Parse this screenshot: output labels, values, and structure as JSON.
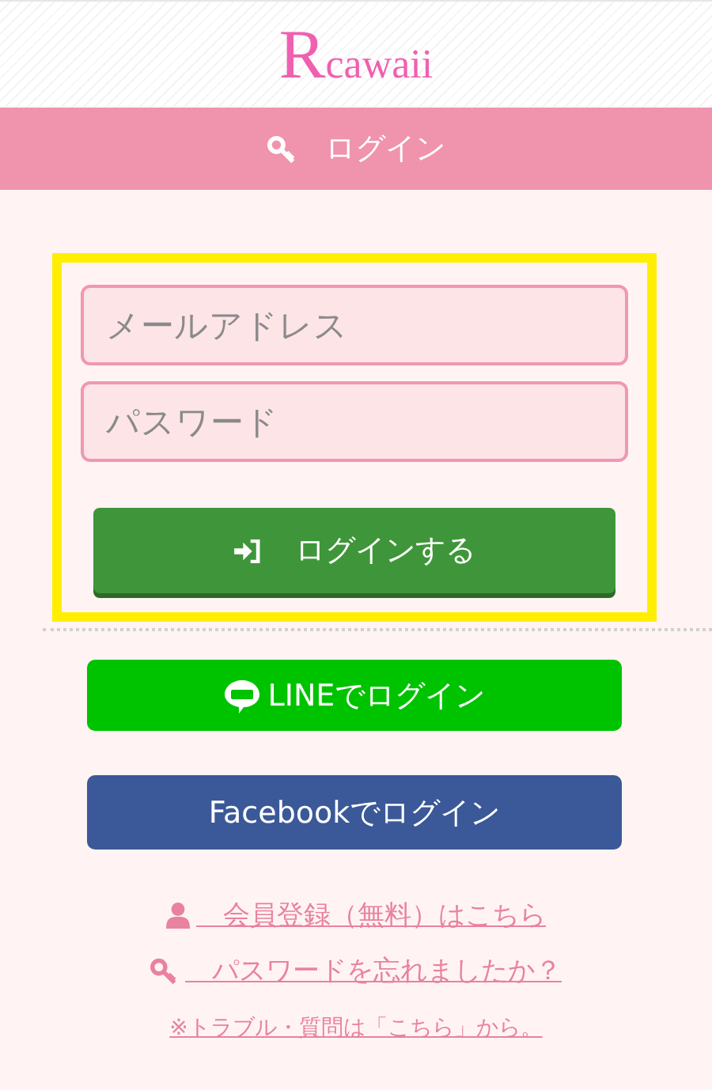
{
  "logo": "Rcawaii",
  "title_bar": {
    "label": "ログイン"
  },
  "form": {
    "highlighted": true,
    "fields": [
      {
        "placeholder": "メールアドレス"
      },
      {
        "placeholder": "パスワード"
      }
    ],
    "submit": "ログインする"
  },
  "social_buttons": [
    {
      "kind": "line",
      "label": "LINEでログイン"
    },
    {
      "kind": "facebook",
      "label": "Facebookでログイン"
    }
  ],
  "links": [
    {
      "kind": "person",
      "label": "　会員登録（無料）はこちら"
    },
    {
      "kind": "key",
      "label": "　パスワードを忘れましたか？"
    },
    {
      "kind": "plain",
      "label": "※トラブル・質問は「こちら」から。"
    }
  ]
}
